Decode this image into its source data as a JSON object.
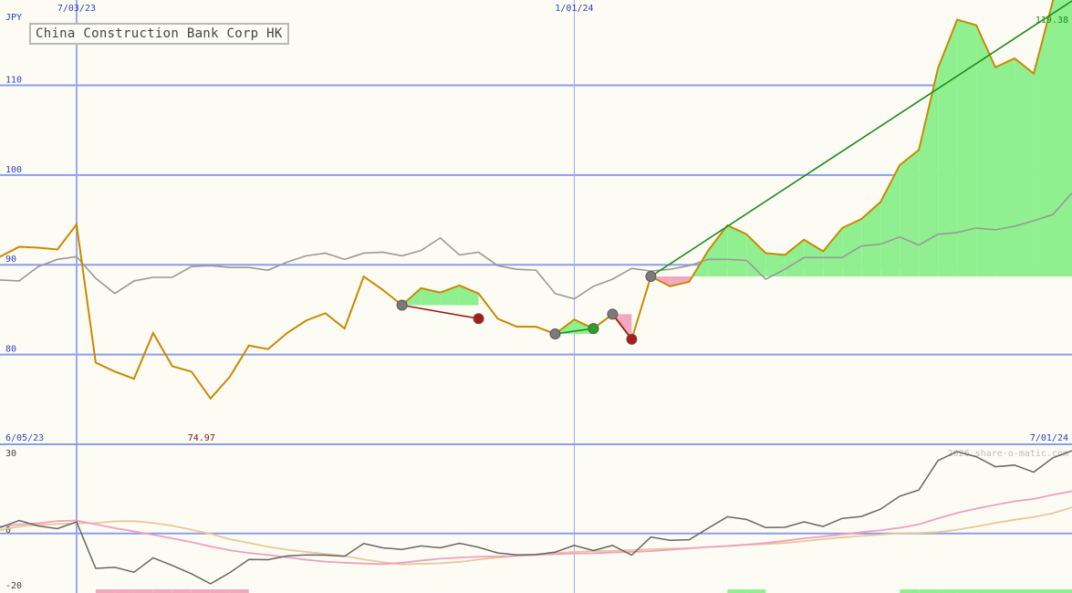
{
  "chart_data": [
    {
      "type": "line",
      "title": "China Construction Bank Corp HK",
      "currency": "JPY",
      "ylim": [
        70.0,
        119.5
      ],
      "yticks": [
        "80",
        "90",
        "100",
        "110"
      ],
      "date_labels": [
        "7/03/23",
        "1/01/24"
      ],
      "start_date": "6/05/23",
      "end_date": "7/01/24",
      "last_price_label": "119.38",
      "low_label": "74.97",
      "x": [
        "6/05/23",
        "6/12/23",
        "6/19/23",
        "6/26/23",
        "7/03/23",
        "7/10/23",
        "7/17/23",
        "7/24/23",
        "7/31/23",
        "8/07/23",
        "8/14/23",
        "8/21/23",
        "8/28/23",
        "9/04/23",
        "9/11/23",
        "9/18/23",
        "9/25/23",
        "10/02/23",
        "10/09/23",
        "10/16/23",
        "10/23/23",
        "10/30/23",
        "11/06/23",
        "11/13/23",
        "11/20/23",
        "11/27/23",
        "12/04/23",
        "12/11/23",
        "12/18/23",
        "12/25/23",
        "1/01/24",
        "1/08/24",
        "1/15/24",
        "1/22/24",
        "1/29/24",
        "2/05/24",
        "2/12/24",
        "2/19/24",
        "2/26/24",
        "3/04/24",
        "3/11/24",
        "3/18/24",
        "3/25/24",
        "4/01/24",
        "4/08/24",
        "4/15/24",
        "4/22/24",
        "4/29/24",
        "5/06/24",
        "5/13/24",
        "5/20/24",
        "5/27/24",
        "6/03/24",
        "6/10/24",
        "6/17/24",
        "6/24/24",
        "7/01/24"
      ],
      "series": [
        {
          "role": "price",
          "color": "#cc8800",
          "values": [
            90.9,
            92.0,
            91.9,
            91.7,
            94.5,
            79.1,
            78.1,
            77.3,
            82.4,
            78.7,
            78.1,
            75.1,
            77.5,
            81.0,
            80.6,
            82.4,
            83.8,
            84.6,
            82.9,
            88.7,
            87.2,
            85.5,
            87.4,
            86.9,
            87.7,
            86.8,
            84.0,
            83.1,
            83.1,
            82.3,
            83.9,
            82.9,
            84.5,
            81.7,
            88.7,
            87.6,
            88.1,
            91.6,
            94.4,
            93.4,
            91.3,
            91.1,
            92.8,
            91.5,
            94.1,
            95.1,
            97.0,
            101.1,
            102.8,
            111.9,
            117.3,
            116.7,
            112.0,
            113.0,
            111.3,
            119.4,
            124.0
          ]
        },
        {
          "role": "relative",
          "color": "#999999",
          "values": [
            88.3,
            88.2,
            89.8,
            90.6,
            90.9,
            88.5,
            86.8,
            88.2,
            88.6,
            88.6,
            89.8,
            89.9,
            89.7,
            89.7,
            89.4,
            90.3,
            91.0,
            91.3,
            90.6,
            91.3,
            91.4,
            91.0,
            91.6,
            93.0,
            91.1,
            91.4,
            89.9,
            89.5,
            89.4,
            86.8,
            86.2,
            87.6,
            88.4,
            89.6,
            89.3,
            89.5,
            89.9,
            90.6,
            90.6,
            90.5,
            88.4,
            89.5,
            90.8,
            90.8,
            90.8,
            92.1,
            92.3,
            93.1,
            92.2,
            93.4,
            93.6,
            94.1,
            93.9,
            94.3,
            94.9,
            95.6,
            98.0
          ]
        }
      ],
      "trades": [
        {
          "entry_date": "10/30/23",
          "entry": 85.5,
          "exit_date": "11/27/23",
          "exit": 84.0,
          "result": "loss"
        },
        {
          "entry_date": "12/25/23",
          "entry": 82.3,
          "exit_date": "1/08/24",
          "exit": 82.9,
          "result": "gain"
        },
        {
          "entry_date": "1/15/24",
          "entry": 84.5,
          "exit_date": "1/22/24",
          "exit": 81.7,
          "result": "loss"
        },
        {
          "entry_date": "1/29/24",
          "entry": 88.7,
          "exit_date": "7/01/24",
          "exit": 119.4,
          "result": "gain"
        }
      ]
    },
    {
      "type": "line",
      "panel": "momentum",
      "watermark": "2026 share-o-matic.com",
      "yticks": [
        "30",
        "0",
        "-20"
      ],
      "ylim": [
        -22,
        33
      ],
      "series": [
        {
          "role": "momentum",
          "color": "#666666",
          "values": [
            2.2,
            4.8,
            2.8,
            1.8,
            4.3,
            -12.9,
            -12.5,
            -14.3,
            -9.0,
            -11.8,
            -14.9,
            -18.6,
            -14.5,
            -9.6,
            -9.7,
            -8.3,
            -7.9,
            -8.0,
            -8.4,
            -3.7,
            -5.3,
            -5.9,
            -4.6,
            -5.3,
            -3.6,
            -5.1,
            -7.2,
            -7.9,
            -7.8,
            -6.9,
            -4.4,
            -6.3,
            -4.4,
            -8.0,
            -1.3,
            -2.5,
            -2.3,
            2.0,
            6.2,
            5.2,
            2.2,
            2.3,
            4.3,
            2.6,
            5.6,
            6.3,
            9.0,
            13.8,
            16.1,
            27.0,
            30.3,
            28.4,
            24.7,
            25.3,
            22.7,
            28.0,
            30.6
          ]
        },
        {
          "role": "signal",
          "color": "#f0a0c0",
          "values": [
            2.6,
            3.4,
            3.8,
            4.6,
            4.8,
            3.4,
            2.0,
            0.8,
            -0.5,
            -1.8,
            -3.2,
            -4.8,
            -6.2,
            -7.2,
            -7.9,
            -8.8,
            -9.7,
            -10.4,
            -10.8,
            -11.1,
            -11.3,
            -10.8,
            -10.0,
            -9.3,
            -8.9,
            -8.6,
            -8.5,
            -8.3,
            -7.9,
            -7.6,
            -7.4,
            -7.3,
            -7.0,
            -6.8,
            -6.5,
            -6.0,
            -5.5,
            -5.0,
            -4.6,
            -4.1,
            -3.5,
            -2.7,
            -1.8,
            -1.1,
            -0.3,
            0.5,
            1.2,
            2.1,
            3.4,
            5.6,
            7.6,
            9.2,
            10.6,
            11.9,
            12.8,
            14.3,
            15.6
          ]
        },
        {
          "role": "slow",
          "color": "#e8c898",
          "values": [
            1.3,
            2.6,
            3.2,
            3.5,
            3.8,
            3.9,
            4.5,
            4.6,
            3.9,
            2.9,
            1.4,
            -0.1,
            -2.1,
            -3.5,
            -4.9,
            -6.0,
            -6.8,
            -7.6,
            -8.3,
            -9.6,
            -10.6,
            -11.4,
            -11.2,
            -11.0,
            -10.5,
            -9.6,
            -8.9,
            -8.3,
            -7.7,
            -7.2,
            -6.8,
            -6.5,
            -6.4,
            -6.1,
            -5.8,
            -5.6,
            -5.4,
            -5.0,
            -4.7,
            -4.2,
            -3.9,
            -3.5,
            -2.8,
            -2.1,
            -1.4,
            -0.9,
            -0.4,
            0.1,
            0.2,
            0.5,
            1.4,
            2.6,
            3.9,
            5.1,
            6.1,
            7.5,
            9.7
          ]
        }
      ]
    }
  ],
  "colors": {
    "background": "#fcfcf4",
    "grid": "#8c9ee8",
    "vertical_grid": "#9aa8f0",
    "gain_fill": "#90f090",
    "loss_fill": "#f4a8c0",
    "trend_gain": "#1e8c1e",
    "trend_loss": "#a01818",
    "label_blue": "#2f3fbf",
    "label_dark": "#222222"
  }
}
